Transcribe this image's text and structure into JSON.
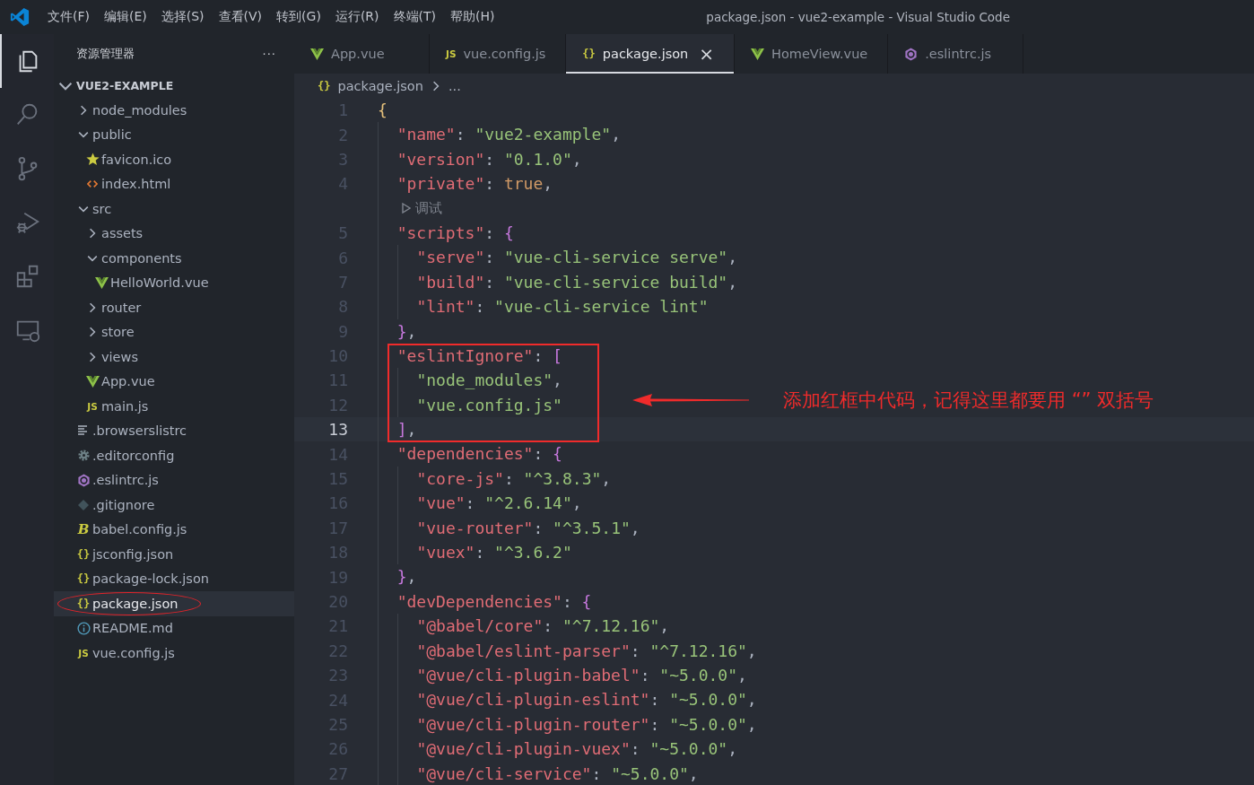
{
  "menu": [
    "文件(F)",
    "编辑(E)",
    "选择(S)",
    "查看(V)",
    "转到(G)",
    "运行(R)",
    "终端(T)",
    "帮助(H)"
  ],
  "window": {
    "title": "package.json - vue2-example - Visual Studio Code"
  },
  "activity_bar": [
    {
      "kind": "explorer",
      "selected": true
    },
    {
      "kind": "search",
      "selected": false
    },
    {
      "kind": "source-control",
      "selected": false
    },
    {
      "kind": "debug",
      "selected": false
    },
    {
      "kind": "extensions",
      "selected": false
    },
    {
      "kind": "remote",
      "selected": false
    }
  ],
  "sidebar": {
    "title": "资源管理器",
    "more": "···",
    "section": {
      "label": "VUE2-EXAMPLE",
      "expanded": true
    },
    "items": [
      {
        "label": "node_modules",
        "kind": "folder",
        "expanded": false,
        "selected": false
      },
      {
        "label": "public",
        "kind": "folder",
        "expanded": true,
        "selected": false,
        "children": [
          {
            "label": "favicon.ico",
            "kind": "star",
            "selected": false
          },
          {
            "label": "index.html",
            "kind": "html",
            "selected": false
          }
        ]
      },
      {
        "label": "src",
        "kind": "folder",
        "expanded": true,
        "selected": false,
        "children": [
          {
            "label": "assets",
            "kind": "folder",
            "expanded": false,
            "selected": false
          },
          {
            "label": "components",
            "kind": "folder",
            "expanded": true,
            "selected": false,
            "children": [
              {
                "label": "HelloWorld.vue",
                "kind": "vue",
                "selected": false
              }
            ]
          },
          {
            "label": "router",
            "kind": "folder",
            "expanded": false,
            "selected": false
          },
          {
            "label": "store",
            "kind": "folder",
            "expanded": false,
            "selected": false
          },
          {
            "label": "views",
            "kind": "folder",
            "expanded": false,
            "selected": false
          },
          {
            "label": "App.vue",
            "kind": "vue",
            "selected": false
          },
          {
            "label": "main.js",
            "kind": "js",
            "badge": "JS",
            "selected": false
          }
        ]
      },
      {
        "label": ".browserslistrc",
        "kind": "lines",
        "selected": false
      },
      {
        "label": ".editorconfig",
        "kind": "gear",
        "selected": false
      },
      {
        "label": ".eslintrc.js",
        "kind": "eslint",
        "selected": false
      },
      {
        "label": ".gitignore",
        "kind": "git",
        "selected": false
      },
      {
        "label": "babel.config.js",
        "kind": "babel",
        "badge": "B",
        "selected": false
      },
      {
        "label": "jsconfig.json",
        "kind": "json",
        "badge": "{}",
        "selected": false
      },
      {
        "label": "package-lock.json",
        "kind": "json",
        "badge": "{}",
        "selected": false
      },
      {
        "label": "package.json",
        "kind": "json",
        "badge": "{}",
        "selected": true,
        "circled": true
      },
      {
        "label": "README.md",
        "kind": "info",
        "selected": false
      },
      {
        "label": "vue.config.js",
        "kind": "js",
        "badge": "JS",
        "selected": false
      }
    ]
  },
  "tabs": [
    {
      "label": "App.vue",
      "kind": "vue",
      "selected": false
    },
    {
      "label": "vue.config.js",
      "kind": "js",
      "badge": "JS",
      "selected": false
    },
    {
      "label": "package.json",
      "kind": "json",
      "badge": "{}",
      "selected": true,
      "close": "×"
    },
    {
      "label": "HomeView.vue",
      "kind": "vue",
      "selected": false
    },
    {
      "label": ".eslintrc.js",
      "kind": "eslint",
      "selected": false
    }
  ],
  "breadcrumb": {
    "badge": "{}",
    "items": [
      "package.json",
      "..."
    ]
  },
  "editor": {
    "lines": [
      {
        "kind": "code",
        "number": "1",
        "tokens": [
          {
            "kind": "bracket",
            "text": "{"
          }
        ]
      },
      {
        "kind": "code",
        "number": "2",
        "tokens": [
          {
            "kind": "key",
            "text": "  \"name\""
          },
          {
            "kind": "punct",
            "text": ": "
          },
          {
            "kind": "string",
            "text": "\"vue2-example\""
          },
          {
            "kind": "punct",
            "text": ","
          }
        ]
      },
      {
        "kind": "code",
        "number": "3",
        "tokens": [
          {
            "kind": "key",
            "text": "  \"version\""
          },
          {
            "kind": "punct",
            "text": ": "
          },
          {
            "kind": "string",
            "text": "\"0.1.0\""
          },
          {
            "kind": "punct",
            "text": ","
          }
        ]
      },
      {
        "kind": "code",
        "number": "4",
        "tokens": [
          {
            "kind": "key",
            "text": "  \"private\""
          },
          {
            "kind": "punct",
            "text": ": "
          },
          {
            "kind": "bool",
            "text": "true"
          },
          {
            "kind": "punct",
            "text": ","
          }
        ]
      },
      {
        "kind": "codelens",
        "text": "调试"
      },
      {
        "kind": "code",
        "number": "5",
        "tokens": [
          {
            "kind": "key",
            "text": "  \"scripts\""
          },
          {
            "kind": "punct",
            "text": ": "
          },
          {
            "kind": "nested",
            "text": "{"
          }
        ]
      },
      {
        "kind": "code",
        "number": "6",
        "tokens": [
          {
            "kind": "key",
            "text": "    \"serve\""
          },
          {
            "kind": "punct",
            "text": ": "
          },
          {
            "kind": "string",
            "text": "\"vue-cli-service serve\""
          },
          {
            "kind": "punct",
            "text": ","
          }
        ]
      },
      {
        "kind": "code",
        "number": "7",
        "tokens": [
          {
            "kind": "key",
            "text": "    \"build\""
          },
          {
            "kind": "punct",
            "text": ": "
          },
          {
            "kind": "string",
            "text": "\"vue-cli-service build\""
          },
          {
            "kind": "punct",
            "text": ","
          }
        ]
      },
      {
        "kind": "code",
        "number": "8",
        "tokens": [
          {
            "kind": "key",
            "text": "    \"lint\""
          },
          {
            "kind": "punct",
            "text": ": "
          },
          {
            "kind": "string",
            "text": "\"vue-cli-service lint\""
          }
        ]
      },
      {
        "kind": "code",
        "number": "9",
        "tokens": [
          {
            "kind": "nested",
            "text": "  }"
          },
          {
            "kind": "punct",
            "text": ","
          }
        ]
      },
      {
        "kind": "code",
        "number": "10",
        "boxed": true,
        "tokens": [
          {
            "kind": "key",
            "text": "  \"eslintIgnore\""
          },
          {
            "kind": "punct",
            "text": ": "
          },
          {
            "kind": "nested",
            "text": "["
          }
        ]
      },
      {
        "kind": "code",
        "number": "11",
        "boxed": true,
        "tokens": [
          {
            "kind": "string",
            "text": "    \"node_modules\""
          },
          {
            "kind": "punct",
            "text": ","
          }
        ]
      },
      {
        "kind": "code",
        "number": "12",
        "boxed": true,
        "tokens": [
          {
            "kind": "string",
            "text": "    \"vue.config.js\""
          }
        ]
      },
      {
        "kind": "code",
        "number": "13",
        "boxed": true,
        "current": true,
        "tokens": [
          {
            "kind": "nested",
            "text": "  ]"
          },
          {
            "kind": "punct",
            "text": ","
          }
        ]
      },
      {
        "kind": "code",
        "number": "14",
        "tokens": [
          {
            "kind": "key",
            "text": "  \"dependencies\""
          },
          {
            "kind": "punct",
            "text": ": "
          },
          {
            "kind": "nested",
            "text": "{"
          }
        ]
      },
      {
        "kind": "code",
        "number": "15",
        "tokens": [
          {
            "kind": "key",
            "text": "    \"core-js\""
          },
          {
            "kind": "punct",
            "text": ": "
          },
          {
            "kind": "string",
            "text": "\"^3.8.3\""
          },
          {
            "kind": "punct",
            "text": ","
          }
        ]
      },
      {
        "kind": "code",
        "number": "16",
        "tokens": [
          {
            "kind": "key",
            "text": "    \"vue\""
          },
          {
            "kind": "punct",
            "text": ": "
          },
          {
            "kind": "string",
            "text": "\"^2.6.14\""
          },
          {
            "kind": "punct",
            "text": ","
          }
        ]
      },
      {
        "kind": "code",
        "number": "17",
        "tokens": [
          {
            "kind": "key",
            "text": "    \"vue-router\""
          },
          {
            "kind": "punct",
            "text": ": "
          },
          {
            "kind": "string",
            "text": "\"^3.5.1\""
          },
          {
            "kind": "punct",
            "text": ","
          }
        ]
      },
      {
        "kind": "code",
        "number": "18",
        "tokens": [
          {
            "kind": "key",
            "text": "    \"vuex\""
          },
          {
            "kind": "punct",
            "text": ": "
          },
          {
            "kind": "string",
            "text": "\"^3.6.2\""
          }
        ]
      },
      {
        "kind": "code",
        "number": "19",
        "tokens": [
          {
            "kind": "nested",
            "text": "  }"
          },
          {
            "kind": "punct",
            "text": ","
          }
        ]
      },
      {
        "kind": "code",
        "number": "20",
        "tokens": [
          {
            "kind": "key",
            "text": "  \"devDependencies\""
          },
          {
            "kind": "punct",
            "text": ": "
          },
          {
            "kind": "nested",
            "text": "{"
          }
        ]
      },
      {
        "kind": "code",
        "number": "21",
        "tokens": [
          {
            "kind": "key",
            "text": "    \"@babel/core\""
          },
          {
            "kind": "punct",
            "text": ": "
          },
          {
            "kind": "string",
            "text": "\"^7.12.16\""
          },
          {
            "kind": "punct",
            "text": ","
          }
        ]
      },
      {
        "kind": "code",
        "number": "22",
        "tokens": [
          {
            "kind": "key",
            "text": "    \"@babel/eslint-parser\""
          },
          {
            "kind": "punct",
            "text": ": "
          },
          {
            "kind": "string",
            "text": "\"^7.12.16\""
          },
          {
            "kind": "punct",
            "text": ","
          }
        ]
      },
      {
        "kind": "code",
        "number": "23",
        "tokens": [
          {
            "kind": "key",
            "text": "    \"@vue/cli-plugin-babel\""
          },
          {
            "kind": "punct",
            "text": ": "
          },
          {
            "kind": "string",
            "text": "\"~5.0.0\""
          },
          {
            "kind": "punct",
            "text": ","
          }
        ]
      },
      {
        "kind": "code",
        "number": "24",
        "tokens": [
          {
            "kind": "key",
            "text": "    \"@vue/cli-plugin-eslint\""
          },
          {
            "kind": "punct",
            "text": ": "
          },
          {
            "kind": "string",
            "text": "\"~5.0.0\""
          },
          {
            "kind": "punct",
            "text": ","
          }
        ]
      },
      {
        "kind": "code",
        "number": "25",
        "tokens": [
          {
            "kind": "key",
            "text": "    \"@vue/cli-plugin-router\""
          },
          {
            "kind": "punct",
            "text": ": "
          },
          {
            "kind": "string",
            "text": "\"~5.0.0\""
          },
          {
            "kind": "punct",
            "text": ","
          }
        ]
      },
      {
        "kind": "code",
        "number": "26",
        "tokens": [
          {
            "kind": "key",
            "text": "    \"@vue/cli-plugin-vuex\""
          },
          {
            "kind": "punct",
            "text": ": "
          },
          {
            "kind": "string",
            "text": "\"~5.0.0\""
          },
          {
            "kind": "punct",
            "text": ","
          }
        ]
      },
      {
        "kind": "code",
        "number": "27",
        "tokens": [
          {
            "kind": "key",
            "text": "    \"@vue/cli-service\""
          },
          {
            "kind": "punct",
            "text": ": "
          },
          {
            "kind": "string",
            "text": "\"~5.0.0\""
          },
          {
            "kind": "punct",
            "text": ","
          }
        ]
      }
    ]
  },
  "annotation": {
    "note": "添加红框中代码，记得这里都要用 “” 双括号"
  }
}
